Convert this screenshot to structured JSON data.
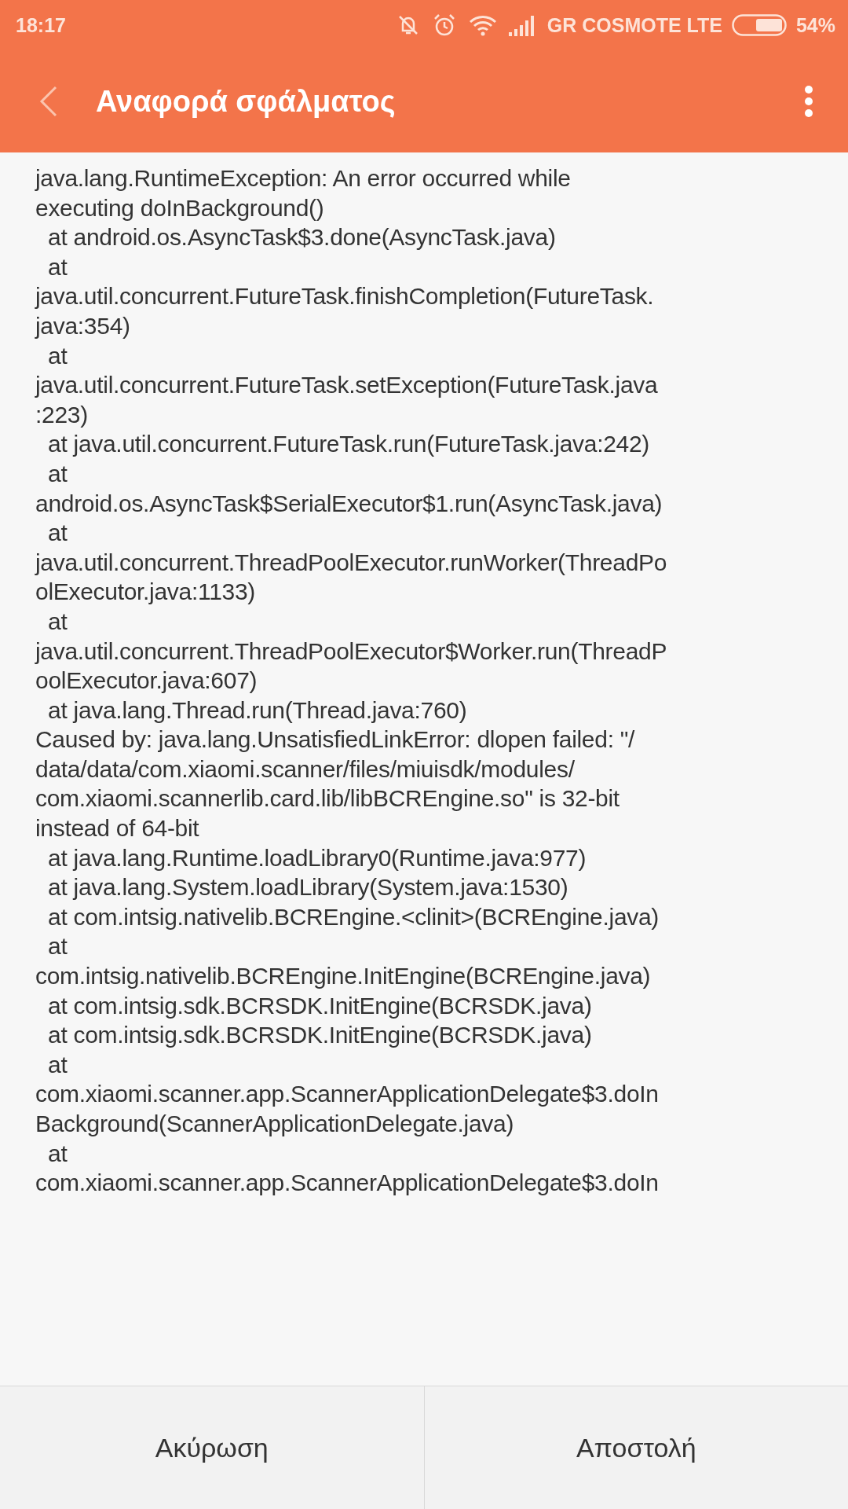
{
  "status_bar": {
    "time": "18:17",
    "carrier": "GR COSMOTE LTE",
    "battery_text": "54%"
  },
  "toolbar": {
    "title": "Αναφορά σφάλματος"
  },
  "report_lines": [
    "java.lang.RuntimeException: An error occurred while",
    "executing doInBackground()",
    "  at android.os.AsyncTask$3.done(AsyncTask.java)",
    "  at",
    "java.util.concurrent.FutureTask.finishCompletion(FutureTask.",
    "java:354)",
    "  at",
    "java.util.concurrent.FutureTask.setException(FutureTask.java",
    ":223)",
    "  at java.util.concurrent.FutureTask.run(FutureTask.java:242)",
    "  at",
    "android.os.AsyncTask$SerialExecutor$1.run(AsyncTask.java)",
    "  at",
    "java.util.concurrent.ThreadPoolExecutor.runWorker(ThreadPo",
    "olExecutor.java:1133)",
    "  at",
    "java.util.concurrent.ThreadPoolExecutor$Worker.run(ThreadP",
    "oolExecutor.java:607)",
    "  at java.lang.Thread.run(Thread.java:760)",
    "Caused by: java.lang.UnsatisfiedLinkError: dlopen failed: \"/",
    "data/data/com.xiaomi.scanner/files/miuisdk/modules/",
    "com.xiaomi.scannerlib.card.lib/libBCREngine.so\" is 32-bit",
    "instead of 64-bit",
    "  at java.lang.Runtime.loadLibrary0(Runtime.java:977)",
    "  at java.lang.System.loadLibrary(System.java:1530)",
    "  at com.intsig.nativelib.BCREngine.<clinit>(BCREngine.java)",
    "  at",
    "com.intsig.nativelib.BCREngine.InitEngine(BCREngine.java)",
    "  at com.intsig.sdk.BCRSDK.InitEngine(BCRSDK.java)",
    "  at com.intsig.sdk.BCRSDK.InitEngine(BCRSDK.java)",
    "  at",
    "com.xiaomi.scanner.app.ScannerApplicationDelegate$3.doIn",
    "Background(ScannerApplicationDelegate.java)",
    "  at",
    "com.xiaomi.scanner.app.ScannerApplicationDelegate$3.doIn"
  ],
  "buttons": [
    {
      "label": "Ακύρωση"
    },
    {
      "label": "Αποστολή"
    }
  ]
}
